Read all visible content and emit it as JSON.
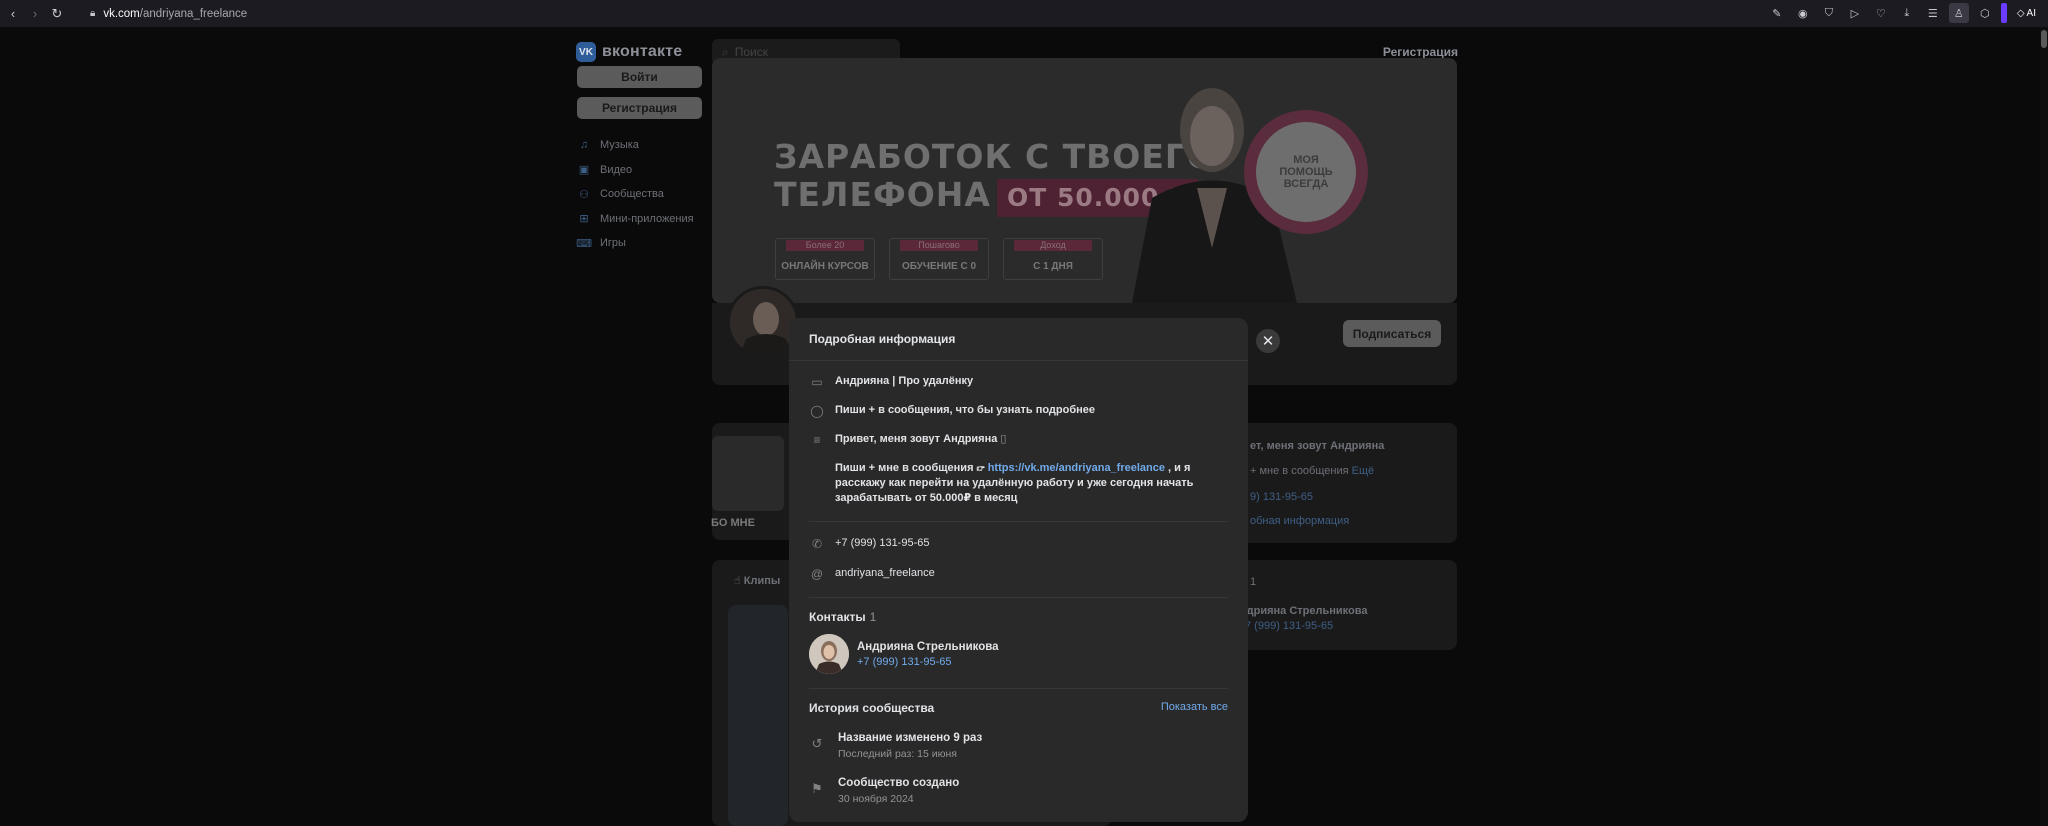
{
  "browser": {
    "url_host": "vk.com",
    "url_path": "/andriyana_freelance",
    "ai_label": "AI"
  },
  "header": {
    "logo_text": "вконтакте",
    "logo_mark": "VK",
    "search_placeholder": "Поиск",
    "register_link": "Регистрация"
  },
  "sidebar": {
    "login_button": "Войти",
    "register_button": "Регистрация",
    "items": [
      {
        "label": "Музыка",
        "icon": "music-icon"
      },
      {
        "label": "Видео",
        "icon": "video-icon"
      },
      {
        "label": "Сообщества",
        "icon": "communities-icon"
      },
      {
        "label": "Мини-приложения",
        "icon": "mini-apps-icon"
      },
      {
        "label": "Игры",
        "icon": "games-icon"
      }
    ]
  },
  "cover": {
    "title_line1": "ЗАРАБОТОК С ТВОЕГО",
    "title_line2": "ТЕЛЕФОНА",
    "price": "ОТ 50.000 Р",
    "badges": [
      {
        "top": "Более 20",
        "main": "ОНЛАЙН КУРСОВ"
      },
      {
        "top": "Пошагово",
        "main": "ОБУЧЕНИЕ С 0"
      },
      {
        "top": "Доход",
        "main": "С 1 ДНЯ"
      }
    ],
    "circle_text_1": "МОЯ",
    "circle_text_2": "ПОМОЩЬ",
    "circle_text_3": "ВСЕГДА"
  },
  "profile": {
    "subscribe_button": "Подписаться"
  },
  "background_panels": {
    "album_caption": "БО МНЕ",
    "clips_label": "Клипы",
    "right_text_1": "ет, меня зовут Андрияна",
    "right_text_2": "+ мне в сообщения",
    "right_more": "Ещё",
    "right_phone": "9) 131-95-65",
    "right_more_info": "обная информация",
    "right_count": "1",
    "right_contact_name": "ндрияна Стрельникова",
    "right_contact_phone": "7 (999) 131-95-65"
  },
  "modal": {
    "title": "Подробная информация",
    "name_line": "Андрияна | Про удалёнку",
    "status_line": "Пиши + в сообщения, что бы узнать подробнее",
    "description_line1": "Привет, меня зовут Андрияна",
    "description_p2_start": "Пиши + мне в сообщения",
    "description_link": "https://vk.me/andriyana_freelance",
    "description_p2_end": ", и я",
    "description_line3": "расскажу как перейти на удалённую работу и уже сегодня начать",
    "description_line4": "зарабатывать от 50.000₽ в месяц",
    "phone": "+7 (999) 131-95-65",
    "screen_name": "andriyana_freelance",
    "contacts_title": "Контакты",
    "contacts_count": "1",
    "contact_name": "Андрияна Стрельникова",
    "contact_phone": "+7 (999) 131-95-65",
    "history_title": "История сообщества",
    "show_all": "Показать все",
    "history": [
      {
        "title": "Название изменено 9 раз",
        "sub": "Последний раз: 15 июня"
      },
      {
        "title": "Сообщество создано",
        "sub": "30 ноября 2024"
      }
    ]
  },
  "colors": {
    "modal_bg": "#292929",
    "link": "#71aaeb",
    "page_bg": "#0a0a0a"
  }
}
